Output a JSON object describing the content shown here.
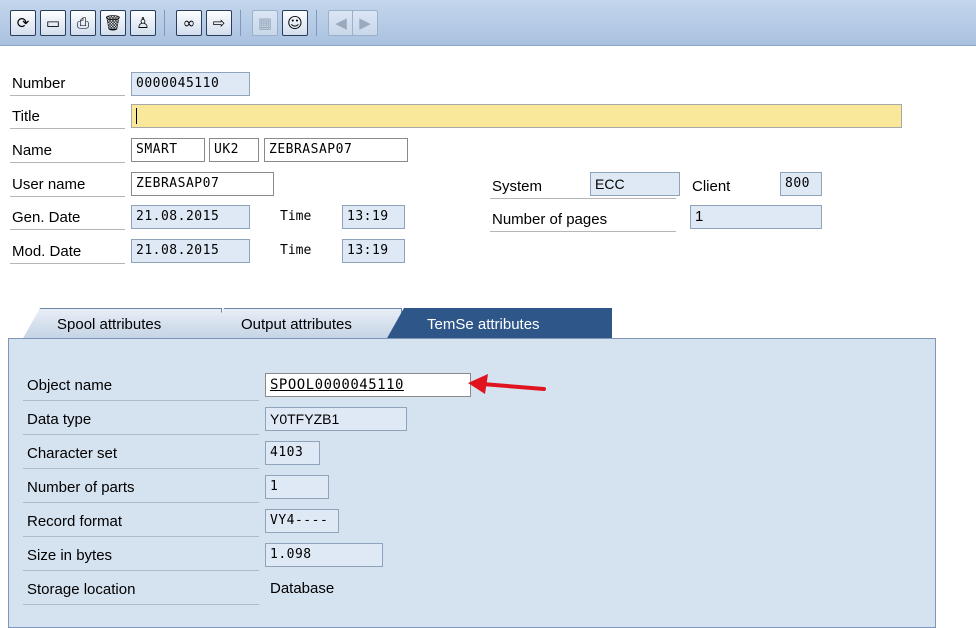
{
  "toolbar": {
    "buttons": [
      {
        "icon": "refresh-icon",
        "glyph": "⟳"
      },
      {
        "icon": "display-icon",
        "glyph": "▭"
      },
      {
        "icon": "print-icon",
        "glyph": "⎙"
      },
      {
        "icon": "delete-icon",
        "glyph": "🗑"
      },
      {
        "icon": "owner-icon",
        "glyph": "♙"
      },
      {
        "icon": "glasses-icon",
        "glyph": "∞"
      },
      {
        "icon": "forward-icon",
        "glyph": "⇨"
      },
      {
        "icon": "attributes-icon",
        "glyph": "▦"
      },
      {
        "icon": "user-icon",
        "glyph": "☺"
      },
      {
        "icon": "previous-icon",
        "glyph": "◀"
      },
      {
        "icon": "next-icon",
        "glyph": "▶"
      }
    ]
  },
  "header": {
    "number_label": "Number",
    "number_value": "0000045110",
    "title_label": "Title",
    "title_value": "",
    "name_label": "Name",
    "name_part1": "SMART",
    "name_part2": "UK2",
    "name_part3": "ZEBRASAP07",
    "user_label": "User name",
    "user_value": "ZEBRASAP07",
    "gen_date_label": "Gen. Date",
    "gen_date_value": "21.08.2015",
    "gen_time_label": "Time",
    "gen_time_value": "13:19",
    "mod_date_label": "Mod. Date",
    "mod_date_value": "21.08.2015",
    "mod_time_label": "Time",
    "mod_time_value": "13:19",
    "system_label": "System",
    "system_value": "ECC",
    "client_label": "Client",
    "client_value": "800",
    "pages_label": "Number of pages",
    "pages_value": "1"
  },
  "tabs": [
    {
      "label": "Spool attributes",
      "active": false
    },
    {
      "label": "Output attributes",
      "active": false
    },
    {
      "label": "TemSe attributes",
      "active": true
    }
  ],
  "temse": {
    "object_name_label": "Object name",
    "object_name_value": "SPOOL0000045110",
    "data_type_label": "Data type",
    "data_type_value": "Y0TFYZB1",
    "charset_label": "Character set",
    "charset_value": "4103",
    "parts_label": "Number of parts",
    "parts_value": "1",
    "record_format_label": "Record format",
    "record_format_value": "VY4----",
    "size_label": "Size in bytes",
    "size_value": "1.098",
    "storage_label": "Storage location",
    "storage_value": "Database"
  },
  "colors": {
    "tab_active": "#2e5688",
    "panel_bg": "#d5e2f0",
    "title_field": "#f9e79a",
    "arrow": "#e0141e"
  }
}
